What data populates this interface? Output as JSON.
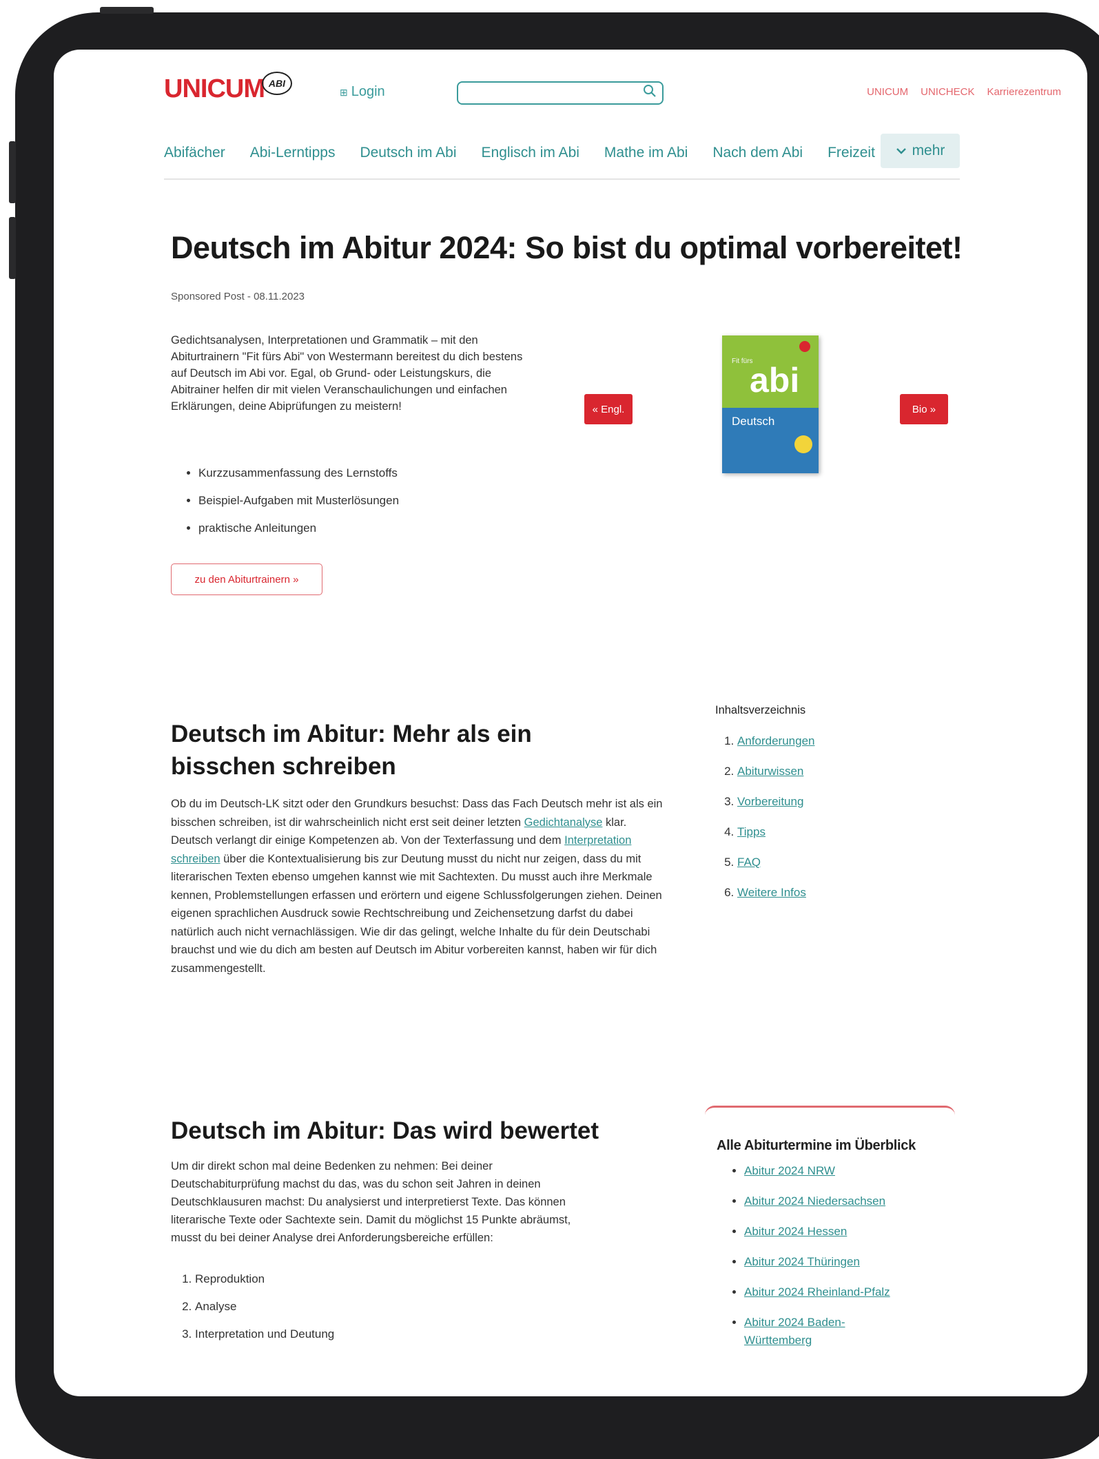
{
  "header": {
    "logo_text": "UNICUM",
    "logo_badge": "ABI",
    "login_label": "Login",
    "search_placeholder": "",
    "top_links": [
      "UNICUM",
      "UNICHECK",
      "Karrierezentrum"
    ]
  },
  "nav": {
    "items": [
      "Abifächer",
      "Abi-Lerntipps",
      "Deutsch im Abi",
      "Englisch im Abi",
      "Mathe im Abi",
      "Nach dem Abi",
      "Freizeit"
    ],
    "more_label": "mehr"
  },
  "article": {
    "title": "Deutsch im Abitur 2024: So bist du optimal vorbereitet!",
    "meta": "Sponsored Post - 08.11.2023"
  },
  "promo": {
    "text": "Gedichtsanalysen, Interpretationen und Grammatik – mit den Abiturtrainern \"Fit fürs Abi\" von Westermann bereitest du dich bestens auf Deutsch im Abi vor. Egal, ob Grund- oder Leistungskurs, die Abitrainer helfen dir mit vielen Veranschaulichungen und einfachen Erklärungen, deine Abiprüfungen zu meistern!",
    "bullets": [
      "Kurzzusammenfassung des Lernstoffs",
      "Beispiel-Aufgaben mit Musterlösungen",
      "praktische Anleitungen"
    ],
    "cta_label": "zu den Abiturtrainern »",
    "prev_label": "« Engl.",
    "next_label": "Bio »",
    "book": {
      "series": "Fit fürs",
      "brand": "abi",
      "subject": "Deutsch"
    }
  },
  "section2": {
    "heading": "Deutsch im Abitur: Mehr als ein bisschen schreiben",
    "body_1": "Ob du im Deutsch-LK sitzt oder den Grundkurs besuchst: Dass das Fach Deutsch mehr ist als ein bisschen schreiben, ist dir wahrscheinlich nicht erst seit deiner letzten ",
    "link_1": "Gedichtanalyse",
    "body_2": " klar. Deutsch verlangt dir einige Kompetenzen ab. Von der Texterfassung und dem ",
    "link_2": "Interpretation schreiben",
    "body_3": " über die Kontextualisierung bis zur Deutung musst du nicht nur zeigen, dass du mit literarischen Texten ebenso umgehen kannst wie mit Sachtexten. Du musst auch ihre Merkmale kennen, Problemstellungen erfassen und erörtern und eigene Schlussfolgerungen ziehen. Deinen eigenen sprachlichen Ausdruck sowie Rechtschreibung und Zeichensetzung darfst du dabei natürlich auch nicht vernachlässigen. Wie dir das gelingt, welche Inhalte du für dein Deutschabi brauchst und wie du dich am besten auf Deutsch im Abitur vorbereiten kannst, haben wir für dich zusammengestellt."
  },
  "toc": {
    "title": "Inhaltsverzeichnis",
    "items": [
      "Anforderungen",
      "Abiturwissen",
      "Vorbereitung",
      "Tipps",
      "FAQ",
      "Weitere Infos"
    ]
  },
  "section3": {
    "heading": "Deutsch im Abitur: Das wird bewertet",
    "body": "Um dir direkt schon mal deine Bedenken zu nehmen: Bei deiner Deutschabiturprüfung machst du das, was du schon seit Jahren in deinen Deutschklausuren machst: Du analysierst und interpretierst Texte. Das können literarische Texte oder Sachtexte sein. Damit du möglichst 15 Punkte abräumst, musst du bei deiner Analyse drei Anforderungsbereiche erfüllen:",
    "items": [
      "Reproduktion",
      "Analyse",
      "Interpretation und Deutung"
    ]
  },
  "dates_box": {
    "title": "Alle Abiturtermine im Überblick",
    "items": [
      "Abitur 2024 NRW",
      "Abitur 2024 Niedersachsen",
      "Abitur 2024 Hessen",
      "Abitur 2024 Thüringen",
      "Abitur 2024 Rheinland-Pfalz",
      "Abitur 2024 Baden-Württemberg"
    ]
  },
  "colors": {
    "brand_red": "#d9262f",
    "teal": "#2f8f8f",
    "frame": "#1e1e20"
  },
  "icons": {
    "login": "login-icon",
    "search": "search-icon",
    "more": "chevron-down-icon"
  }
}
